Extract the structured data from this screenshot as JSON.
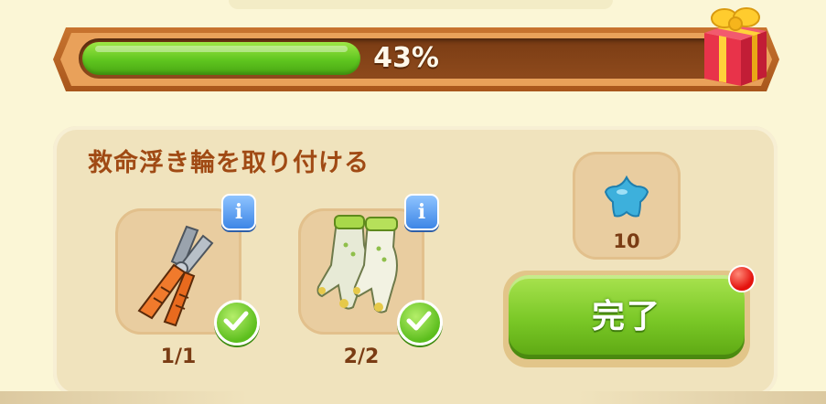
{
  "progress": {
    "percent_label": "43%",
    "value": 0.43
  },
  "task": {
    "title": "救命浮き輪を取り付ける"
  },
  "requirements": [
    {
      "icon": "pliers-icon",
      "count": "1/1",
      "info": "i",
      "done": true
    },
    {
      "icon": "gloves-icon",
      "count": "2/2",
      "info": "i",
      "done": true
    }
  ],
  "reward": {
    "icon": "blue-star-icon",
    "count": "10"
  },
  "complete_button": {
    "label": "完了"
  },
  "colors": {
    "progress_fill": "#5fc51f",
    "button_green": "#79c726",
    "title_brown": "#a04a14",
    "info_blue": "#3d86e6",
    "notification_red": "#e4130e"
  }
}
